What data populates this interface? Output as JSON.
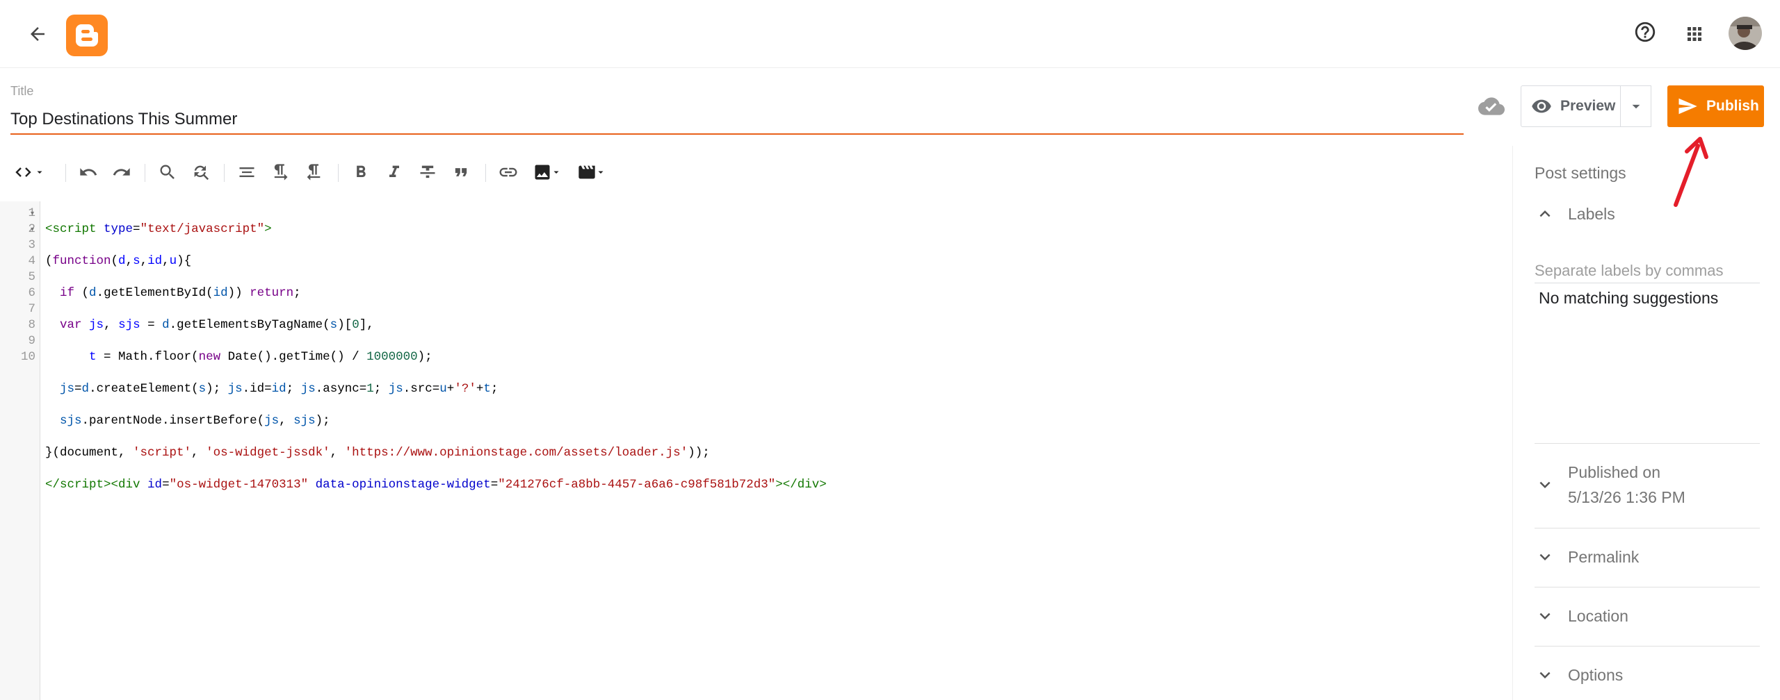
{
  "header": {
    "back_icon": "arrow-back-icon",
    "logo_icon": "blogger-logo",
    "help_icon": "help-icon",
    "apps_icon": "apps-grid-icon",
    "avatar_icon": "user-avatar"
  },
  "title": {
    "label": "Title",
    "value": "Top Destinations This Summer"
  },
  "actions": {
    "save_status_icon": "cloud-done-icon",
    "preview_label": "Preview",
    "publish_label": "Publish",
    "accent_color": "#f57c00"
  },
  "toolbar": {
    "items": [
      "code-mode-icon",
      "undo-icon",
      "redo-icon",
      "search-icon",
      "replace-icon",
      "align-icon",
      "paragraph-ltr-icon",
      "paragraph-rtl-icon",
      "bold-icon",
      "italic-icon",
      "strikethrough-icon",
      "quote-icon",
      "link-icon",
      "image-icon",
      "video-icon"
    ]
  },
  "editor": {
    "line_numbers": [
      "1",
      "2",
      "3",
      "4",
      "5",
      "6",
      "7",
      "8",
      "9",
      "10"
    ]
  },
  "sidebar": {
    "title": "Post settings",
    "labels": {
      "title": "Labels",
      "placeholder": "Separate labels by commas",
      "suggestion": "No matching suggestions"
    },
    "published_on": {
      "title": "Published on",
      "value": "5/13/26 1:36 PM"
    },
    "permalink": "Permalink",
    "location": "Location",
    "options": "Options"
  }
}
